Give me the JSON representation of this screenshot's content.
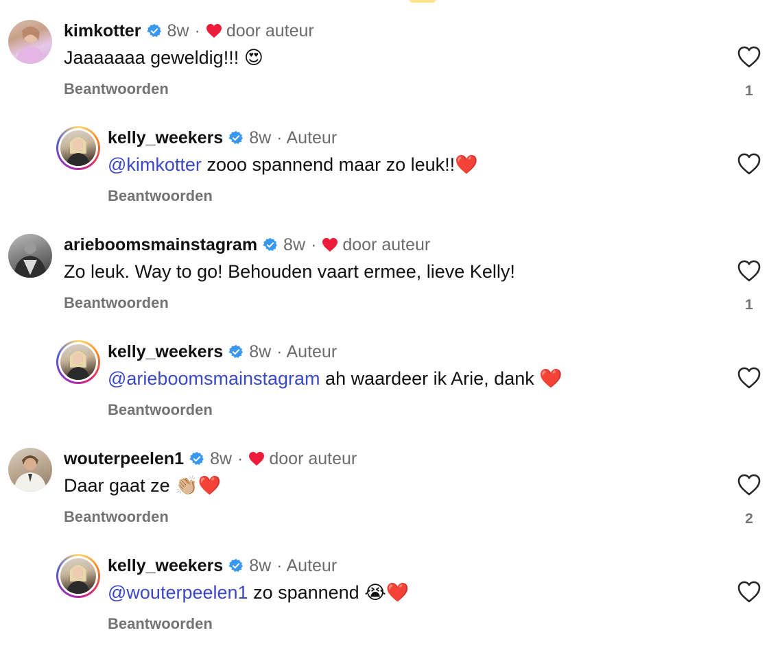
{
  "comments": [
    {
      "username": "kimkotter",
      "time": "8w",
      "separator": "·",
      "liked_label": "door auteur",
      "text_before": "Jaaaaaaa geweldig!!!",
      "text_emoji": "😍",
      "reply_label": "Beantwoorden",
      "like_count": "1",
      "reply": {
        "username": "kelly_weekers",
        "time": "8w",
        "separator": "·",
        "author_label": "Auteur",
        "mention": "@kimkotter",
        "text": "zooo spannend maar zo leuk!!",
        "text_emoji": "❤️",
        "reply_label": "Beantwoorden"
      }
    },
    {
      "username": "arieboomsmainstagram",
      "time": "8w",
      "separator": "·",
      "liked_label": "door auteur",
      "text_before": "Zo leuk. Way to go! Behouden vaart ermee, lieve Kelly!",
      "text_emoji": "",
      "reply_label": "Beantwoorden",
      "like_count": "1",
      "reply": {
        "username": "kelly_weekers",
        "time": "8w",
        "separator": "·",
        "author_label": "Auteur",
        "mention": "@arieboomsmainstagram",
        "text": "ah waardeer ik Arie, dank",
        "text_emoji": "❤️",
        "reply_label": "Beantwoorden"
      }
    },
    {
      "username": "wouterpeelen1",
      "time": "8w",
      "separator": "·",
      "liked_label": "door auteur",
      "text_before": "Daar gaat ze",
      "text_emoji": "👏🏼❤️",
      "reply_label": "Beantwoorden",
      "like_count": "2",
      "reply": {
        "username": "kelly_weekers",
        "time": "8w",
        "separator": "·",
        "author_label": "Auteur",
        "mention": "@wouterpeelen1",
        "text": "zo spannend",
        "text_emoji": "😭❤️",
        "reply_label": "Beantwoorden"
      }
    }
  ],
  "colors": {
    "mention": "#3b48c8",
    "verified": "#3897f0",
    "heart": "#ed1c3a",
    "muted": "#737373"
  }
}
